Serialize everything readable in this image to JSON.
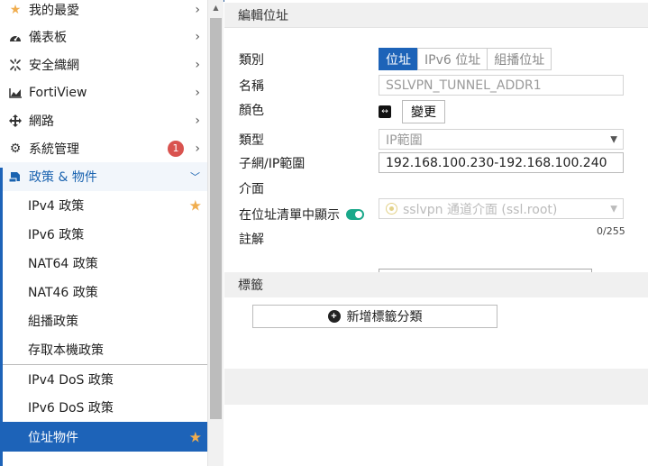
{
  "sidebar": {
    "top_items": [
      {
        "label": "我的最愛",
        "icon": "star-icon"
      },
      {
        "label": "儀表板",
        "icon": "dashboard-icon"
      },
      {
        "label": "安全織網",
        "icon": "security-fabric-icon"
      },
      {
        "label": "FortiView",
        "icon": "chart-icon"
      },
      {
        "label": "網路",
        "icon": "network-icon"
      },
      {
        "label": "系統管理",
        "icon": "gear-icon",
        "badge": "1"
      }
    ],
    "section": {
      "label": "政策 & 物件",
      "icon": "policy-icon"
    },
    "sub_items": [
      {
        "label": "IPv4 政策",
        "starred": true
      },
      {
        "label": "IPv6 政策"
      },
      {
        "label": "NAT64 政策"
      },
      {
        "label": "NAT46 政策"
      },
      {
        "label": "組播政策"
      },
      {
        "label": "存取本機政策"
      },
      {
        "label": "IPv4 DoS 政策"
      },
      {
        "label": "IPv6 DoS 政策"
      },
      {
        "label": "位址物件",
        "active": true,
        "starred": true
      }
    ]
  },
  "panel": {
    "title": "編輯位址",
    "labels": {
      "category": "類別",
      "name": "名稱",
      "color": "顏色",
      "type": "類型",
      "subnet": "子網/IP範圍",
      "interface": "介面",
      "show_in_list": "在位址清單中顯示",
      "comment": "註解"
    },
    "category_tabs": [
      "位址",
      "IPv6 位址",
      "組播位址"
    ],
    "name_value": "SSLVPN_TUNNEL_ADDR1",
    "change_button": "變更",
    "type_value": "IP範圍",
    "subnet_value": "192.168.100.230-192.168.100.240",
    "interface_value": "sslvpn 通道介面 (ssl.root)",
    "comment_counter": "0/255",
    "tags_title": "標籤",
    "add_tag_button": "新增標籤分類"
  },
  "colors": {
    "accent": "#1d63b8",
    "toggle_on": "#1aa88a",
    "badge": "#d9534f",
    "star": "#f0ad4e"
  }
}
